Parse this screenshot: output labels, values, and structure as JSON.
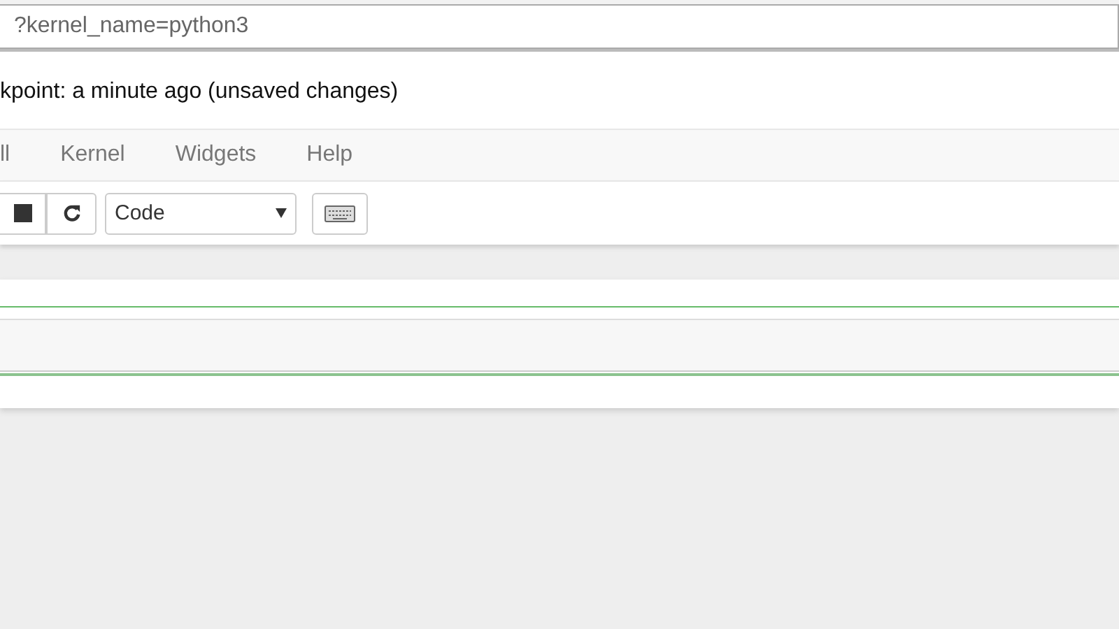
{
  "address_bar": {
    "url": "?kernel_name=python3"
  },
  "header": {
    "checkpoint": "kpoint: a minute ago (unsaved changes)"
  },
  "menu": [
    "ll",
    "Kernel",
    "Widgets",
    "Help"
  ],
  "toolbar": {
    "cell_type": "Code"
  },
  "cells": [
    {
      "kind": "output"
    },
    {
      "kind": "input"
    }
  ]
}
